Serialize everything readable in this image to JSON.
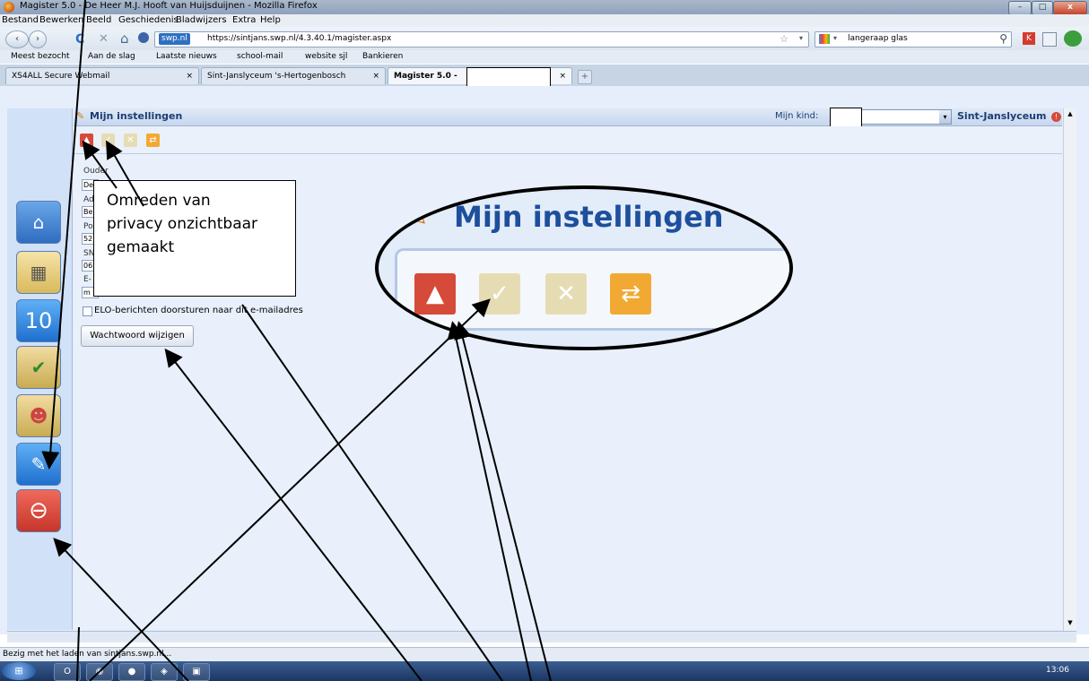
{
  "window": {
    "title": "Magister 5.0 - De Heer M.J. Hooft van Huijsduijnen - Mozilla Firefox",
    "controls": {
      "minimize": "–",
      "maximize": "□",
      "close": "x"
    }
  },
  "menu": [
    "Bestand",
    "Bewerken",
    "Beeld",
    "Geschiedenis",
    "Bladwijzers",
    "Extra",
    "Help"
  ],
  "nav": {
    "back": "‹",
    "forward": "›",
    "reload": "C",
    "stop": "✕",
    "home": "⌂",
    "site_badge": "swp.nl",
    "url": "https://sintjans.swp.nl/4.3.40.1/magister.aspx",
    "search_value": "langeraap glas"
  },
  "bookmarks": [
    "Meest bezocht",
    "Aan de slag",
    "Laatste nieuws",
    "school-mail",
    "website sjl",
    "Bankieren"
  ],
  "tabs": [
    {
      "label": "XS4ALL Secure Webmail",
      "close": "×"
    },
    {
      "label": "Sint-Janslyceum 's-Hertogenbosch",
      "close": "×"
    },
    {
      "label": "Magister 5.0 -",
      "close": "×"
    }
  ],
  "new_tab": "+",
  "app": {
    "page_title": "Mijn instellingen",
    "kind_label": "Mijn kind:",
    "kind_arrow": "▾",
    "school": "Sint-Janslyceum",
    "warn": "!",
    "toolbar_icons": {
      "collapse": "▲",
      "save": "✓",
      "cancel": "✕",
      "refresh": "⇄"
    },
    "form_labels": [
      "Ouder",
      "Ad",
      "Po",
      "SN",
      "E-"
    ],
    "form_values": [
      "De",
      "Be",
      "52",
      "06",
      "m"
    ],
    "elo_checkbox": "ELO-berichten doorsturen naar dit e-mailadres",
    "password_button": "Wachtwoord wijzigen",
    "sidebar_icons": {
      "calendar_number": "10",
      "logout": "⊖",
      "home": "⌂",
      "agenda": "▦",
      "check": "✔",
      "people": "☻",
      "settings": "✎"
    }
  },
  "callout": {
    "lines": [
      "Omreden van",
      "privacy onzichtbaar",
      "gemaakt"
    ]
  },
  "zoom": {
    "title": "Mijn instellingen"
  },
  "status": "Bezig met het laden van sintjans.swp.nl...",
  "taskbar": {
    "clock": "13:06",
    "start": "⊞",
    "apps": [
      "O",
      "◉",
      "●",
      "◈",
      "▣"
    ]
  },
  "colors": {
    "header_text": "#1d3c73",
    "collapse_red": "#d64a3a",
    "disabled_tan": "#e6dcb4",
    "refresh_orange": "#f2a933"
  }
}
